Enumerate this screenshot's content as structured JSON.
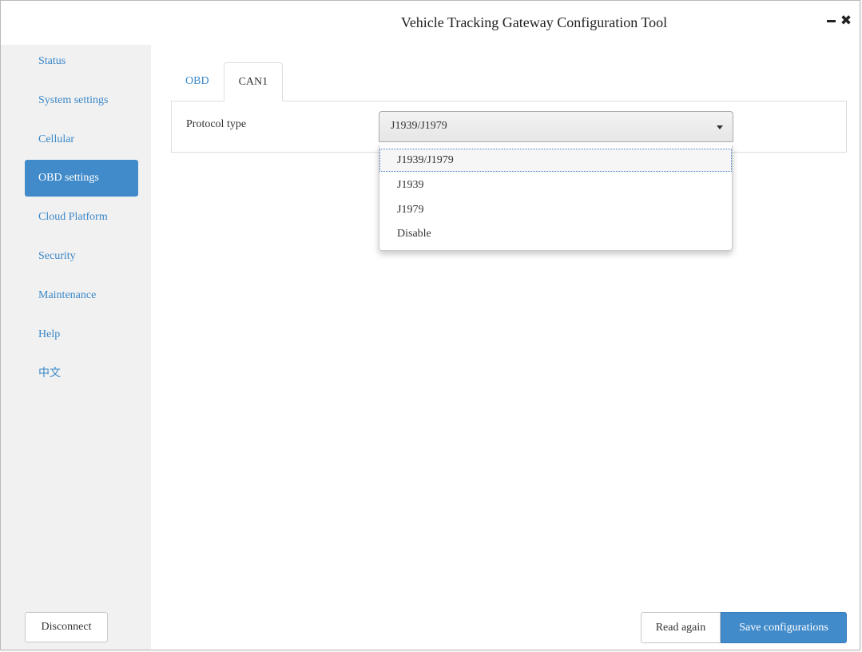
{
  "window": {
    "title": "Vehicle Tracking Gateway Configuration Tool"
  },
  "sidebar": {
    "items": [
      {
        "label": "Status"
      },
      {
        "label": "System settings"
      },
      {
        "label": "Cellular"
      },
      {
        "label": "OBD settings",
        "active": true
      },
      {
        "label": "Cloud Platform"
      },
      {
        "label": "Security"
      },
      {
        "label": "Maintenance"
      },
      {
        "label": "Help"
      },
      {
        "label": "中文"
      }
    ],
    "disconnect_label": "Disconnect"
  },
  "tabs": [
    {
      "label": "OBD",
      "active": false
    },
    {
      "label": "CAN1",
      "active": true
    }
  ],
  "form": {
    "protocol_label": "Protocol type",
    "protocol_value": "J1939/J1979",
    "options": [
      "J1939/J1979",
      "J1939",
      "J1979",
      "Disable"
    ]
  },
  "actions": {
    "read_again": "Read again",
    "save": "Save configurations"
  },
  "colors": {
    "accent": "#428bca",
    "link": "#3a87c8",
    "sidebar_bg": "#f1f1f1"
  },
  "icons": {
    "minimize": "minimize-icon",
    "close": "close-icon",
    "dropdown": "caret-down-icon"
  }
}
